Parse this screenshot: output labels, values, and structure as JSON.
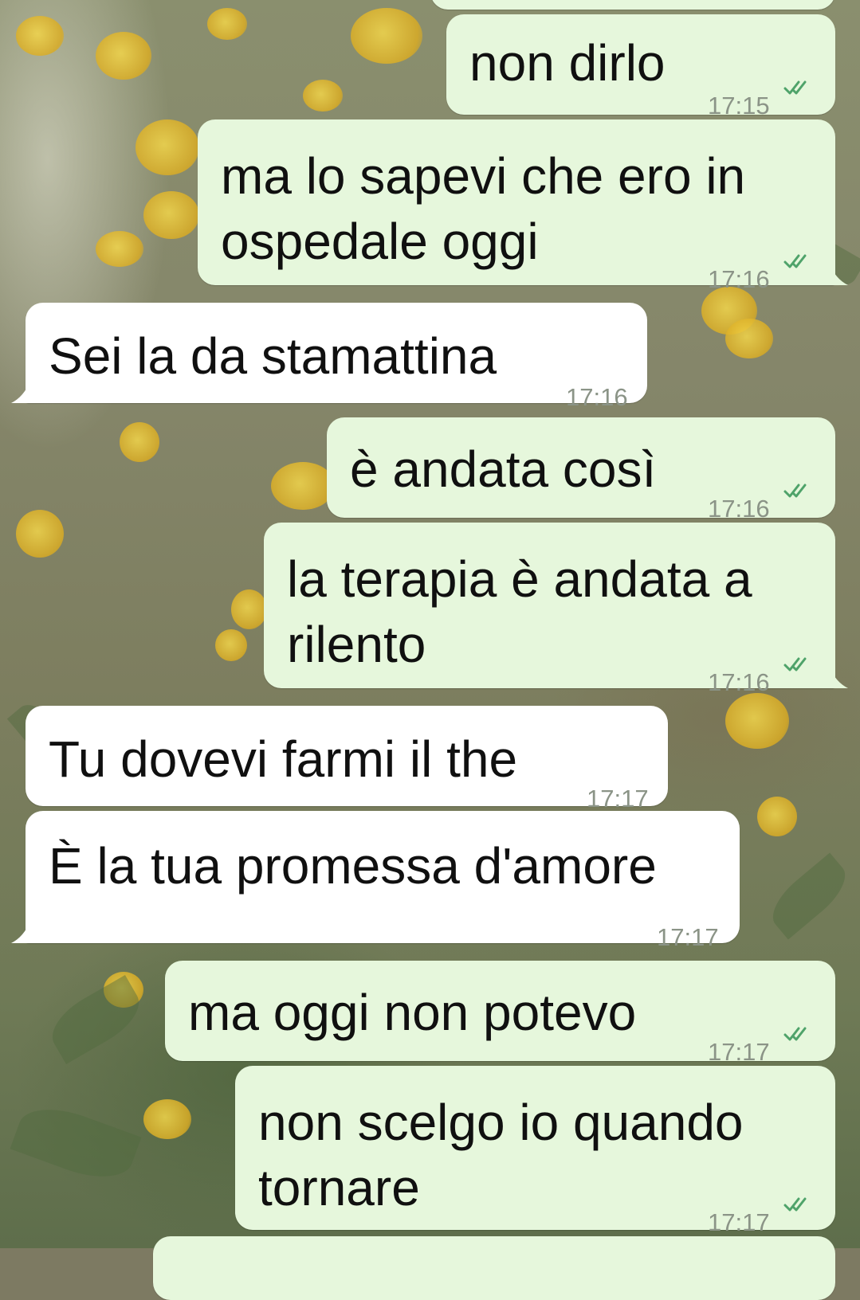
{
  "colors": {
    "outgoing_bubble": "#e6f7dc",
    "incoming_bubble": "#ffffff",
    "read_ticks": "#4fa36a",
    "timestamp": "#8b9487"
  },
  "messages": [
    {
      "direction": "outgoing",
      "lines": [
        "non dirlo"
      ],
      "time": "17:15",
      "status_icon": "double-check-icon"
    },
    {
      "direction": "outgoing",
      "lines": [
        "ma lo sapevi che ero in",
        "ospedale oggi"
      ],
      "time": "17:16",
      "status_icon": "double-check-icon"
    },
    {
      "direction": "incoming",
      "lines": [
        "Sei la da stamattina"
      ],
      "time": "17:16"
    },
    {
      "direction": "outgoing",
      "lines": [
        "è andata così"
      ],
      "time": "17:16",
      "status_icon": "double-check-icon"
    },
    {
      "direction": "outgoing",
      "lines": [
        "la terapia è andata a",
        "rilento"
      ],
      "time": "17:16",
      "status_icon": "double-check-icon"
    },
    {
      "direction": "incoming",
      "lines": [
        "Tu dovevi farmi il the"
      ],
      "time": "17:17"
    },
    {
      "direction": "incoming",
      "lines": [
        "È la tua promessa d'amore"
      ],
      "time": "17:17"
    },
    {
      "direction": "outgoing",
      "lines": [
        "ma oggi non potevo"
      ],
      "time": "17:17",
      "status_icon": "double-check-icon"
    },
    {
      "direction": "outgoing",
      "lines": [
        "non scelgo io quando",
        "tornare"
      ],
      "time": "17:17",
      "status_icon": "double-check-icon"
    }
  ]
}
